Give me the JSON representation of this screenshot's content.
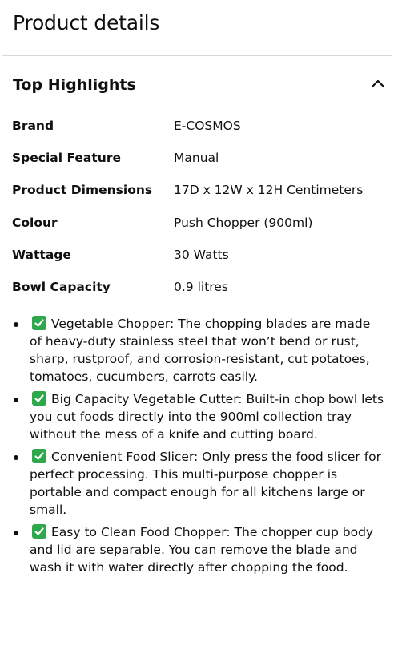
{
  "page_title": "Product details",
  "section": {
    "title": "Top Highlights",
    "icon": "chevron-up-icon",
    "expanded": true
  },
  "specs": [
    {
      "key": "Brand",
      "value": "E-COSMOS"
    },
    {
      "key": "Special Feature",
      "value": "Manual"
    },
    {
      "key": "Product Dimensions",
      "value": "17D x 12W x 12H Centimeters"
    },
    {
      "key": "Colour",
      "value": "Push Chopper (900ml)"
    },
    {
      "key": "Wattage",
      "value": "30 Watts"
    },
    {
      "key": "Bowl Capacity",
      "value": "0.9 litres"
    }
  ],
  "highlights": [
    {
      "icon": "check-mark-icon",
      "text": "Vegetable Chopper: The chopping blades are made of heavy-duty stainless steel that won’t bend or rust, sharp, rustproof, and corrosion-resistant, cut potatoes, tomatoes, cucumbers, carrots easily."
    },
    {
      "icon": "check-mark-icon",
      "text": "Big Capacity Vegetable Cutter: Built-in chop bowl lets you cut foods directly into the 900ml collection tray without the mess of a knife and cutting board."
    },
    {
      "icon": "check-mark-icon",
      "text": "Convenient Food Slicer: Only press the food slicer for perfect processing. This multi-purpose chopper is portable and compact enough for all kitchens large or small."
    },
    {
      "icon": "check-mark-icon",
      "text": "Easy to Clean Food Chopper: The chopper cup body and lid are separable. You can remove the blade and wash it with water directly after chopping the food."
    }
  ],
  "colors": {
    "text": "#0f1111",
    "divider": "#d5d9d9",
    "check_bg": "#2ea84a"
  }
}
